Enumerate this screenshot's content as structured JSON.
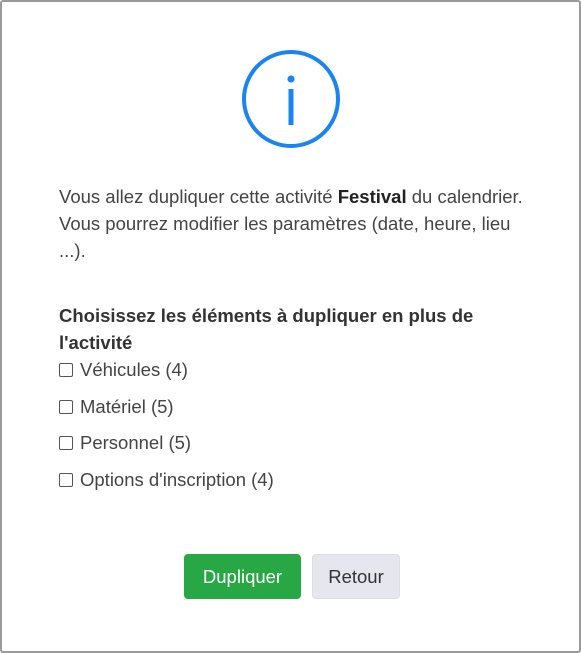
{
  "dialog": {
    "icon": "info-circle-icon",
    "accent_color": "#1a85f0",
    "message": {
      "before": "Vous allez dupliquer cette activité ",
      "activity_name": "Festival",
      "after": " du calendrier. Vous pourrez modifier les paramètres (date, heure, lieu ...)."
    },
    "section_title": "Choisissez les éléments à dupliquer en plus de l'activité",
    "options": [
      {
        "label": "Véhicules (4)",
        "checked": false
      },
      {
        "label": "Matériel (5)",
        "checked": false
      },
      {
        "label": "Personnel (5)",
        "checked": false
      },
      {
        "label": "Options d'inscription (4)",
        "checked": false
      }
    ],
    "buttons": {
      "confirm_label": "Dupliquer",
      "confirm_color": "#28a745",
      "back_label": "Retour"
    }
  }
}
